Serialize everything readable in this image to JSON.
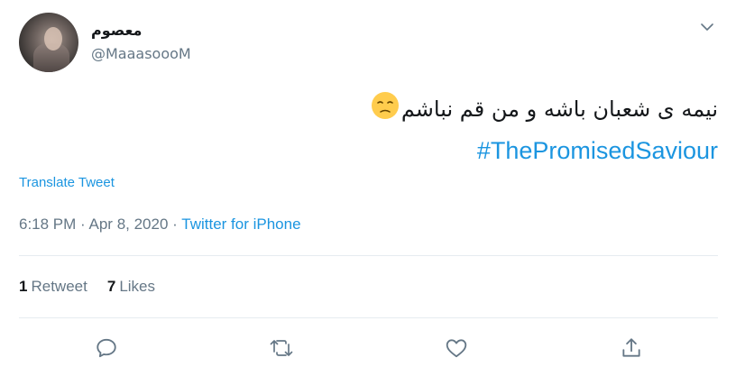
{
  "user": {
    "display_name": "معصوم",
    "handle": "@MaaasoooM"
  },
  "tweet": {
    "text": "نیمه ی شعبان باشه و من قم نباشم",
    "emoji": "pensive-face-emoji",
    "hashtag": "#ThePromisedSaviour",
    "translate_label": "Translate Tweet",
    "time": "6:18 PM",
    "date": "Apr 8, 2020",
    "separator": "·",
    "source": "Twitter for iPhone"
  },
  "stats": {
    "retweets_count": "1",
    "retweets_label": "Retweet",
    "likes_count": "7",
    "likes_label": "Likes"
  },
  "actions": [
    "reply-icon",
    "retweet-icon",
    "like-icon",
    "share-icon"
  ],
  "colors": {
    "link": "#1b95e0",
    "muted": "#657786",
    "text": "#14171a",
    "divider": "#e6ecf0"
  }
}
